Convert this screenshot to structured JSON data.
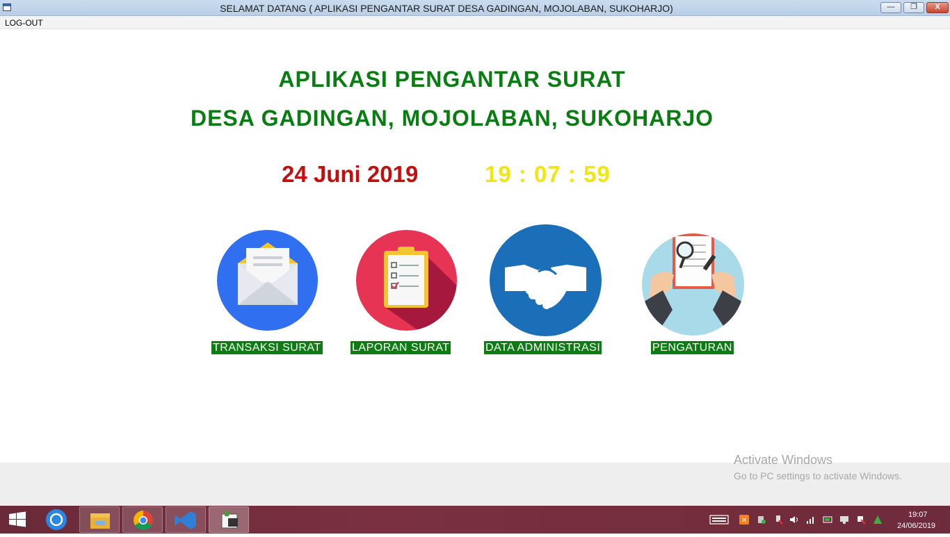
{
  "window": {
    "title": "SELAMAT DATANG ( APLIKASI PENGANTAR SURAT DESA GADINGAN, MOJOLABAN, SUKOHARJO)",
    "min_glyph": "—",
    "max_glyph": "❐",
    "close_glyph": "X"
  },
  "menu": {
    "logout": "LOG-OUT"
  },
  "main": {
    "heading_line1": "APLIKASI PENGANTAR SURAT",
    "heading_line2": "DESA GADINGAN, MOJOLABAN, SUKOHARJO",
    "date": "24 Juni 2019",
    "time": "19 : 07 : 59",
    "tiles": [
      {
        "label": "TRANSAKSI SURAT",
        "icon": "envelope-icon",
        "color": "#2f6ff0"
      },
      {
        "label": "LAPORAN SURAT",
        "icon": "clipboard-checklist-icon",
        "color": "#e83454"
      },
      {
        "label": "DATA ADMINISTRASI",
        "icon": "handshake-icon",
        "color": "#1a6fb8"
      },
      {
        "label": "PENGATURAN",
        "icon": "magnifier-document-icon",
        "color": "#a8daea"
      }
    ]
  },
  "watermark": {
    "line1": "Activate Windows",
    "line2": "Go to PC settings to activate Windows."
  },
  "taskbar": {
    "clock_time": "19:07",
    "clock_date": "24/06/2019",
    "apps": [
      "start-icon",
      "shareit-icon",
      "file-explorer-icon",
      "chrome-icon",
      "visual-studio-icon",
      "app-32-icon"
    ]
  }
}
